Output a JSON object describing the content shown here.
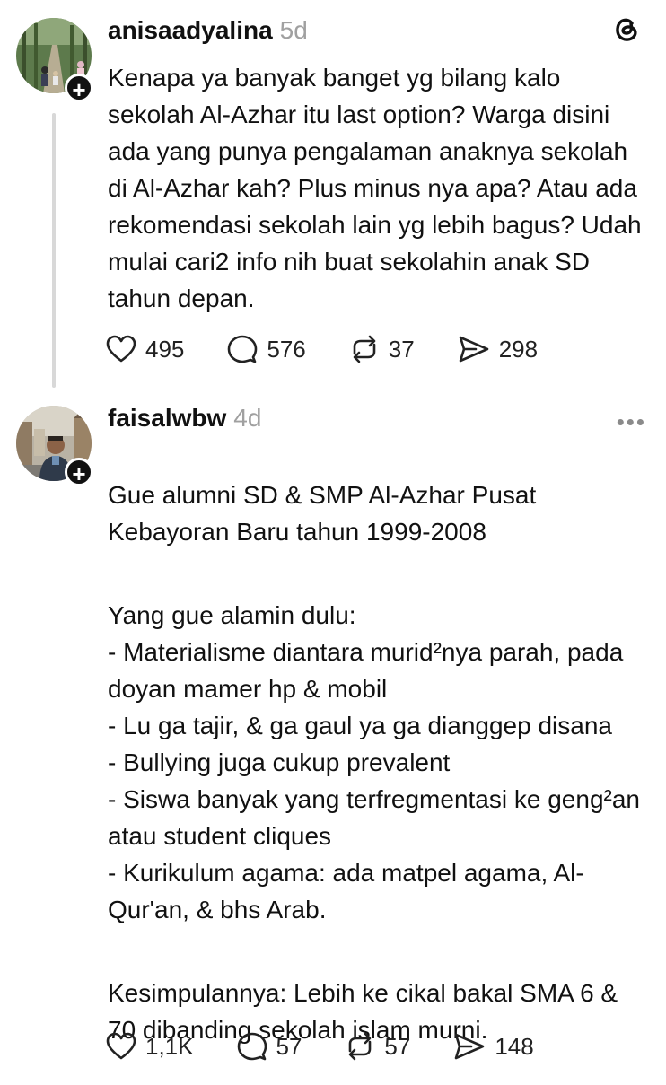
{
  "posts": [
    {
      "username": "anisaadyalina",
      "time": "5d",
      "text": "Kenapa ya banyak banget yg bilang kalo sekolah Al-Azhar itu last option? Warga disini ada yang punya pengalaman anaknya sekolah di Al-Azhar kah? Plus minus nya apa? Atau ada rekomendasi sekolah lain yg lebih bagus? Udah mulai cari2 info nih buat sekolahin anak SD tahun depan.",
      "likes": "495",
      "replies": "576",
      "reposts": "37",
      "shares": "298"
    },
    {
      "username": "faisalwbw",
      "time": "4d",
      "paragraphs": [
        "Gue alumni SD & SMP Al-Azhar Pusat Kebayoran Baru tahun 1999-2008",
        "Yang gue alamin dulu:\n- Materialisme diantara murid²nya parah, pada doyan mamer hp & mobil\n- Lu ga tajir, & ga gaul ya ga dianggep disana\n- Bullying juga cukup prevalent\n- Siswa banyak yang terfregmentasi ke geng²an atau student cliques\n- Kurikulum agama: ada matpel agama, Al-Qur'an, & bhs Arab.",
        "Kesimpulannya: Lebih ke cikal bakal SMA 6 & 70 dibanding sekolah islam murni."
      ],
      "likes": "1,1K",
      "replies": "57",
      "reposts": "57",
      "shares": "148"
    }
  ],
  "plus_symbol": "+",
  "more_symbol": "•••",
  "icons": {
    "app": "threads-logo-icon",
    "like": "heart-icon",
    "reply": "comment-icon",
    "repost": "repost-icon",
    "share": "share-icon"
  }
}
